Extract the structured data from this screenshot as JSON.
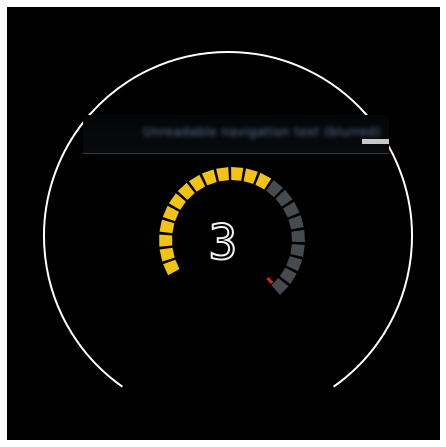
{
  "display": {
    "gear": "3",
    "info_text": "Unreadable navigation text (blurred)",
    "rpm_gauge": {
      "total_segments": 22,
      "lit_segments": 13,
      "redline_segments": 1,
      "lit_color": "#f2c314",
      "unlit_color": "#454b4e",
      "redline_color": "#e02020"
    },
    "ring_color": "#ffffff",
    "info_line_color": "#8a1a1a"
  }
}
